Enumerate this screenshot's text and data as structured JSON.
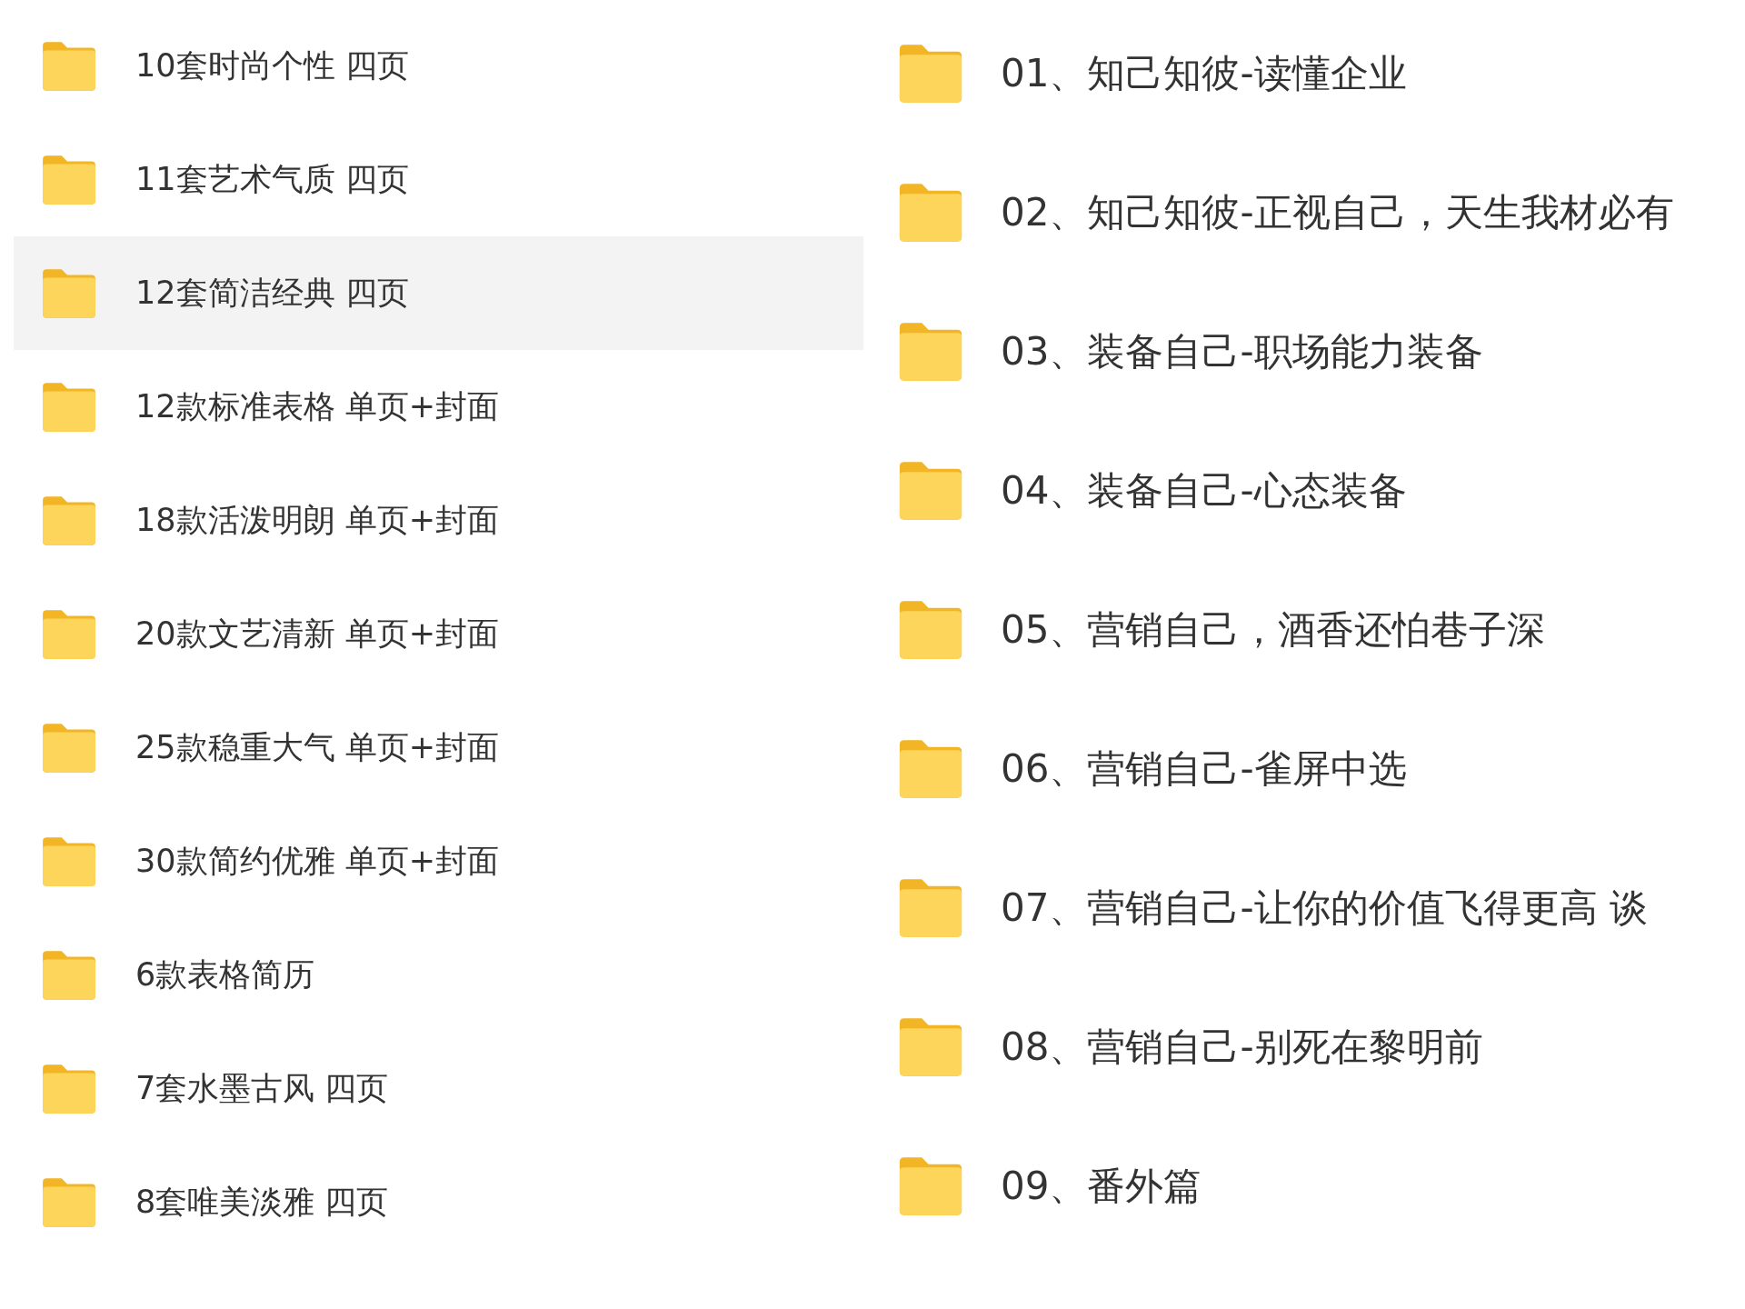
{
  "left_folders": [
    {
      "name": "10套时尚个性 四页",
      "selected": false
    },
    {
      "name": "11套艺术气质 四页",
      "selected": false
    },
    {
      "name": "12套简洁经典 四页",
      "selected": true
    },
    {
      "name": "12款标准表格 单页+封面",
      "selected": false
    },
    {
      "name": "18款活泼明朗 单页+封面",
      "selected": false
    },
    {
      "name": "20款文艺清新 单页+封面",
      "selected": false
    },
    {
      "name": "25款稳重大气 单页+封面",
      "selected": false
    },
    {
      "name": "30款简约优雅 单页+封面",
      "selected": false
    },
    {
      "name": "6款表格简历",
      "selected": false
    },
    {
      "name": "7套水墨古风 四页",
      "selected": false
    },
    {
      "name": "8套唯美淡雅 四页",
      "selected": false
    }
  ],
  "right_folders": [
    {
      "name": "01、知己知彼-读懂企业"
    },
    {
      "name": "02、知己知彼-正视自己，天生我材必有"
    },
    {
      "name": "03、装备自己-职场能力装备"
    },
    {
      "name": "04、装备自己-心态装备"
    },
    {
      "name": "05、营销自己，酒香还怕巷子深"
    },
    {
      "name": "06、营销自己-雀屏中选"
    },
    {
      "name": "07、营销自己-让你的价值飞得更高 谈"
    },
    {
      "name": "08、营销自己-别死在黎明前"
    },
    {
      "name": "09、番外篇"
    }
  ]
}
